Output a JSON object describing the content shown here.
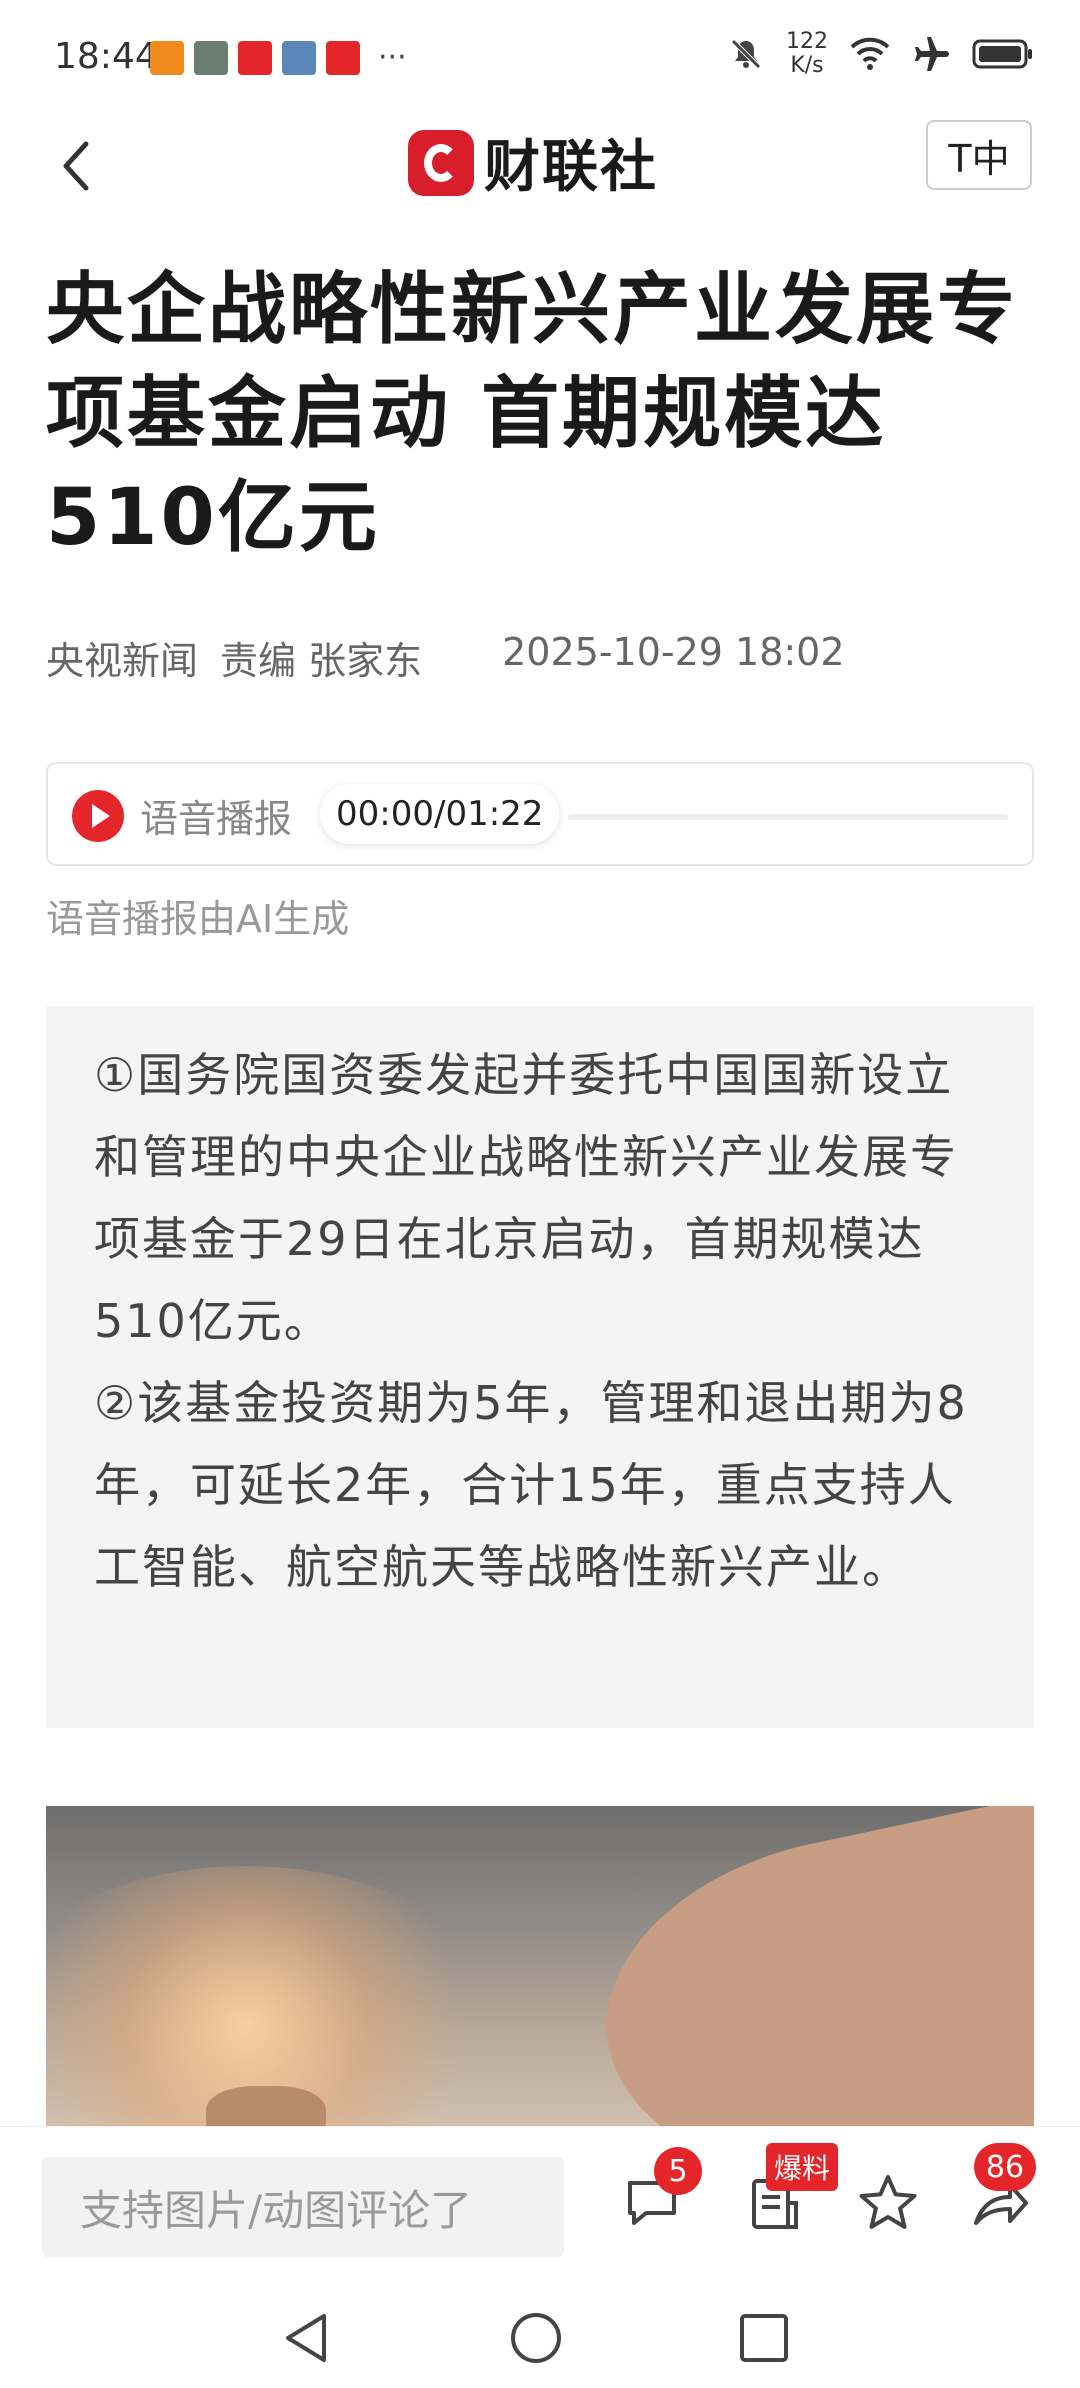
{
  "status_bar": {
    "time": "18:44",
    "network_speed_value": "122",
    "network_speed_unit": "K/s",
    "more": "···"
  },
  "nav": {
    "logo_text": "财联社",
    "font_size_button": "T中"
  },
  "article": {
    "title": "央企战略性新兴产业发展专项基金启动 首期规模达510亿元",
    "source": "央视新闻",
    "editor": "责编 张家东",
    "date": "2025-10-29 18:02"
  },
  "audio": {
    "label": "语音播报",
    "time": "00:00/01:22",
    "progress": 0,
    "note": "语音播报由AI生成"
  },
  "summary": {
    "point1": "①国务院国资委发起并委托中国国新设立和管理的中央企业战略性新兴产业发展专项基金于29日在北京启动，首期规模达510亿元。",
    "point2": "②该基金投资期为5年，管理和退出期为8年，可延长2年，合计15年，重点支持人工智能、航空航天等战略性新兴产业。"
  },
  "bottom_bar": {
    "comment_placeholder": "支持图片/动图评论了",
    "comment_count": "5",
    "report_label": "爆料",
    "share_count": "86"
  },
  "icons": {
    "accent_color": "#e4262b",
    "status_left": [
      "app-icon",
      "photo-icon",
      "toutiao-icon",
      "photo-icon",
      "toutiao-icon"
    ],
    "status_right": [
      "mute-icon",
      "wifi-icon",
      "airplane-icon",
      "battery-icon"
    ]
  }
}
